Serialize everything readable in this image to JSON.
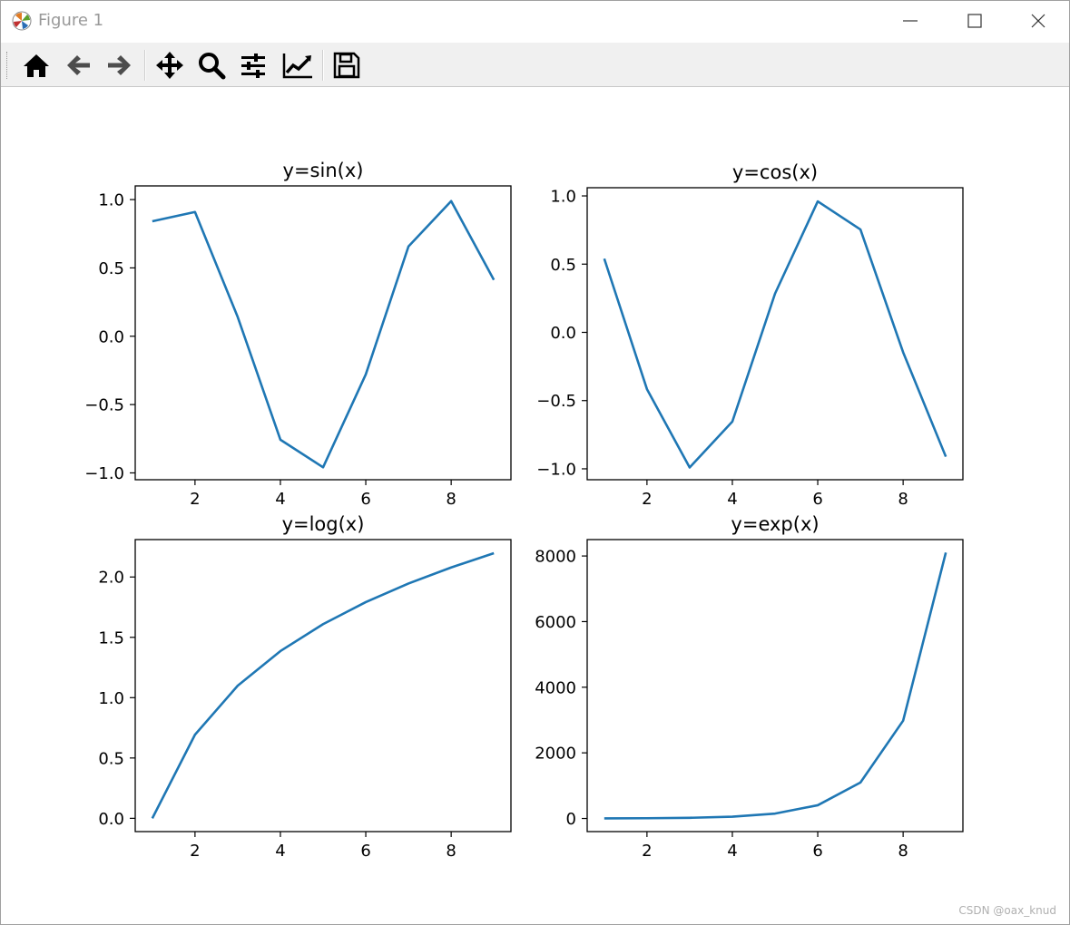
{
  "window": {
    "title": "Figure 1",
    "controls": [
      "minimize",
      "maximize",
      "close"
    ]
  },
  "toolbar": {
    "buttons": [
      {
        "name": "home",
        "icon": "home-icon"
      },
      {
        "name": "back",
        "icon": "arrow-left-icon"
      },
      {
        "name": "forward",
        "icon": "arrow-right-icon"
      },
      {
        "name": "pan",
        "icon": "move-icon"
      },
      {
        "name": "zoom",
        "icon": "magnifier-icon"
      },
      {
        "name": "configure-subplots",
        "icon": "sliders-icon"
      },
      {
        "name": "edit-axis",
        "icon": "line-chart-icon"
      },
      {
        "name": "save",
        "icon": "floppy-disk-icon"
      }
    ]
  },
  "watermark": "CSDN @oax_knud",
  "colors": {
    "line": "#1f77b4"
  },
  "chart_data": [
    {
      "type": "line",
      "title": "y=sin(x)",
      "x": [
        1,
        2,
        3,
        4,
        5,
        6,
        7,
        8,
        9
      ],
      "series": [
        {
          "values": [
            0.841,
            0.909,
            0.141,
            -0.757,
            -0.959,
            -0.279,
            0.657,
            0.989,
            0.412
          ]
        }
      ],
      "xlim": [
        0.6,
        9.4
      ],
      "ylim": [
        -1.05,
        1.1
      ],
      "xticks": [
        2,
        4,
        6,
        8
      ],
      "yticks": [
        -1.0,
        -0.5,
        0.0,
        0.5,
        1.0
      ],
      "xtick_labels": [
        "2",
        "4",
        "6",
        "8"
      ],
      "ytick_labels": [
        "−1.0",
        "−0.5",
        "0.0",
        "0.5",
        "1.0"
      ]
    },
    {
      "type": "line",
      "title": "y=cos(x)",
      "x": [
        1,
        2,
        3,
        4,
        5,
        6,
        7,
        8,
        9
      ],
      "series": [
        {
          "values": [
            0.54,
            -0.416,
            -0.99,
            -0.654,
            0.284,
            0.96,
            0.754,
            -0.146,
            -0.911
          ]
        }
      ],
      "xlim": [
        0.6,
        9.4
      ],
      "ylim": [
        -1.08,
        1.06
      ],
      "xticks": [
        2,
        4,
        6,
        8
      ],
      "yticks": [
        -1.0,
        -0.5,
        0.0,
        0.5,
        1.0
      ],
      "xtick_labels": [
        "2",
        "4",
        "6",
        "8"
      ],
      "ytick_labels": [
        "−1.0",
        "−0.5",
        "0.0",
        "0.5",
        "1.0"
      ]
    },
    {
      "type": "line",
      "title": "y=log(x)",
      "x": [
        1,
        2,
        3,
        4,
        5,
        6,
        7,
        8,
        9
      ],
      "series": [
        {
          "values": [
            0.0,
            0.693,
            1.099,
            1.386,
            1.609,
            1.792,
            1.946,
            2.079,
            2.197
          ]
        }
      ],
      "xlim": [
        0.6,
        9.4
      ],
      "ylim": [
        -0.11,
        2.31
      ],
      "xticks": [
        2,
        4,
        6,
        8
      ],
      "yticks": [
        0.0,
        0.5,
        1.0,
        1.5,
        2.0
      ],
      "xtick_labels": [
        "2",
        "4",
        "6",
        "8"
      ],
      "ytick_labels": [
        "0.0",
        "0.5",
        "1.0",
        "1.5",
        "2.0"
      ]
    },
    {
      "type": "line",
      "title": "y=exp(x)",
      "x": [
        1,
        2,
        3,
        4,
        5,
        6,
        7,
        8,
        9
      ],
      "series": [
        {
          "values": [
            2.718,
            7.389,
            20.09,
            54.6,
            148.4,
            403.4,
            1096.6,
            2981.0,
            8103.1
          ]
        }
      ],
      "xlim": [
        0.6,
        9.4
      ],
      "ylim": [
        -400,
        8500
      ],
      "xticks": [
        2,
        4,
        6,
        8
      ],
      "yticks": [
        0,
        2000,
        4000,
        6000,
        8000
      ],
      "xtick_labels": [
        "2",
        "4",
        "6",
        "8"
      ],
      "ytick_labels": [
        "0",
        "2000",
        "4000",
        "6000",
        "8000"
      ]
    }
  ]
}
